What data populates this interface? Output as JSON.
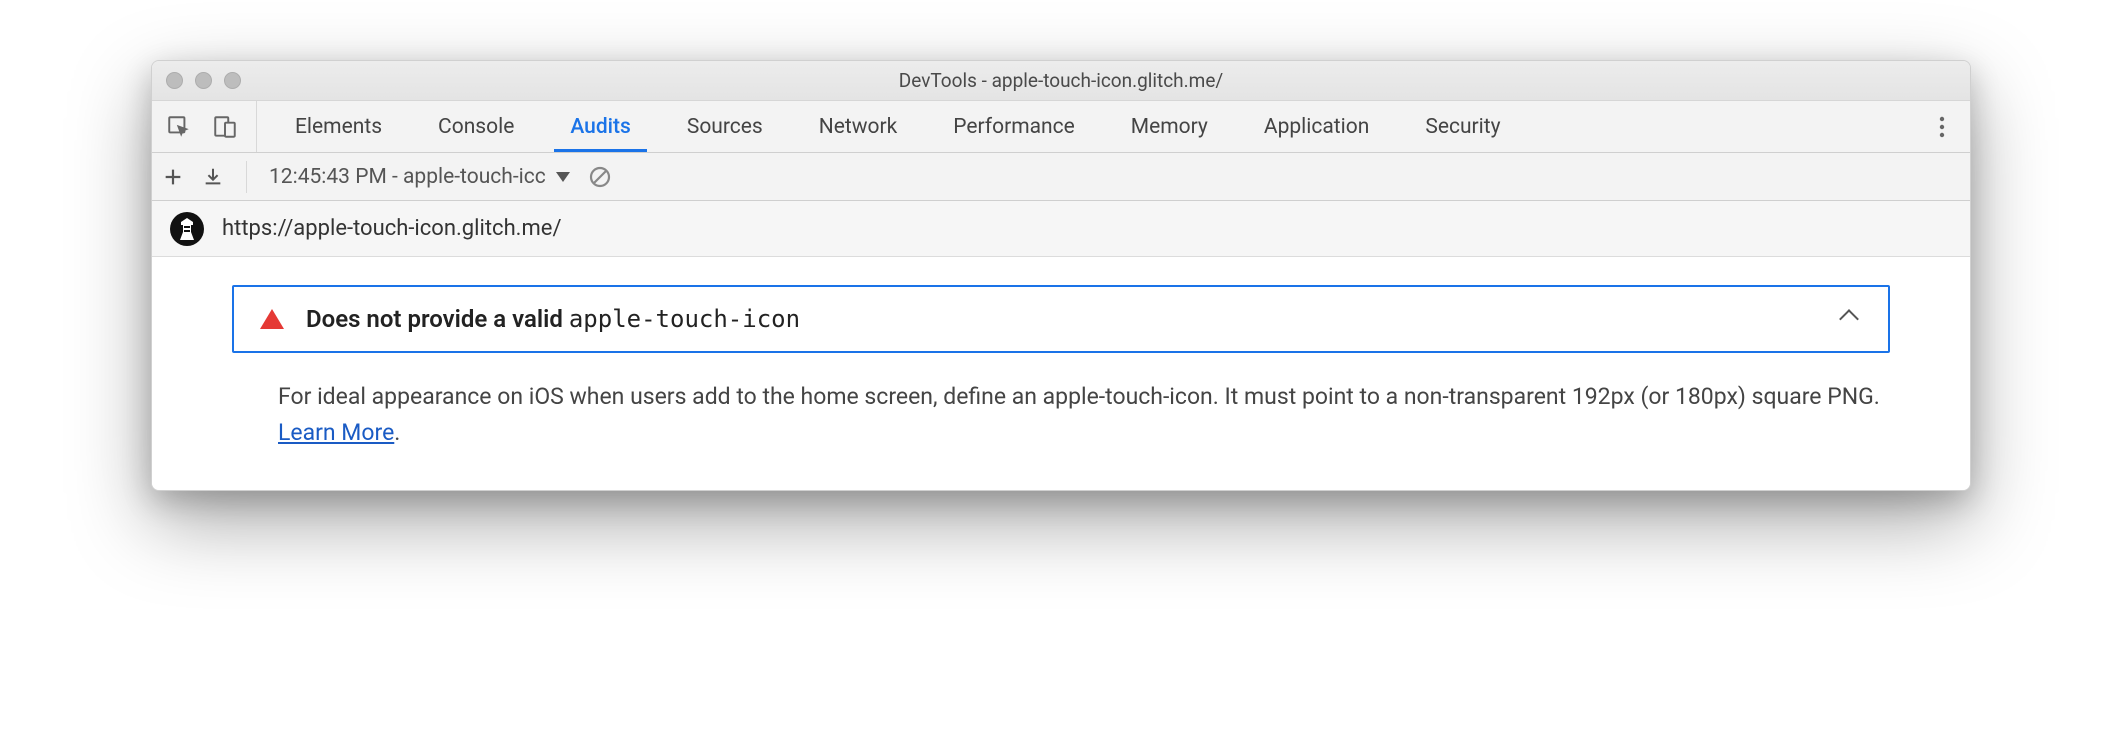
{
  "window": {
    "title": "DevTools - apple-touch-icon.glitch.me/"
  },
  "tabs": {
    "items": [
      {
        "label": "Elements"
      },
      {
        "label": "Console"
      },
      {
        "label": "Audits",
        "active": true
      },
      {
        "label": "Sources"
      },
      {
        "label": "Network"
      },
      {
        "label": "Performance"
      },
      {
        "label": "Memory"
      },
      {
        "label": "Application"
      },
      {
        "label": "Security"
      }
    ]
  },
  "audits_toolbar": {
    "run_label": "12:45:43 PM - apple-touch-icc"
  },
  "report": {
    "url": "https://apple-touch-icon.glitch.me/"
  },
  "audit": {
    "title_prefix": "Does not provide a valid ",
    "title_code": "apple-touch-icon",
    "description_before_link": "For ideal appearance on iOS when users add to the home screen, define an apple-touch-icon. It must point to a non-transparent 192px (or 180px) square PNG. ",
    "learn_more": "Learn More",
    "period": "."
  }
}
